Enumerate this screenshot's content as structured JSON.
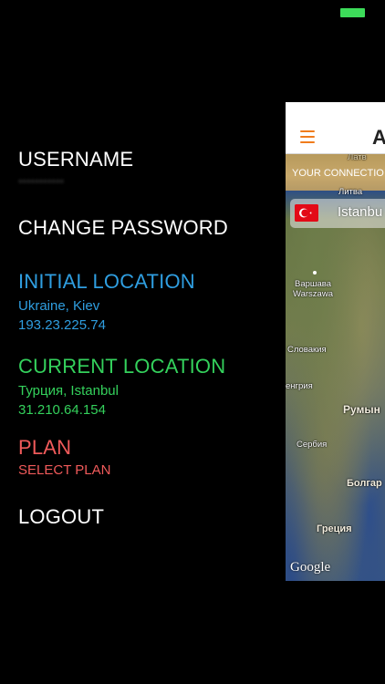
{
  "status_bar": {
    "battery_color": "#3ddc5a"
  },
  "menu": {
    "username_label": "USERNAME",
    "change_password_label": "CHANGE PASSWORD",
    "initial_location": {
      "title": "INITIAL LOCATION",
      "place": "Ukraine, Kiev",
      "ip": "193.23.225.74",
      "color": "#2f9ee0"
    },
    "current_location": {
      "title": "CURRENT LOCATION",
      "place": "Турция, Istanbul",
      "ip": "31.210.64.154",
      "color": "#34d15c"
    },
    "plan": {
      "title": "PLAN",
      "action": "SELECT PLAN",
      "color": "#f05a5a"
    },
    "logout_label": "LOGOUT"
  },
  "app_panel": {
    "menu_icon": "hamburger-icon",
    "title_fragment": "A",
    "banner_text": "YOUR CONNECTIO",
    "location_chip": {
      "flag_icon": "turkey-flag-icon",
      "city": "Istanbu"
    },
    "map_labels": {
      "latvia": "Латв",
      "lithuania": "Литва",
      "warsaw_ru": "Варшава",
      "warsaw": "Warszawa",
      "slovakia": "Словакия",
      "hungary": "енгрия",
      "romania": "Румын",
      "serbia": "Сербия",
      "bulgaria": "Болгар",
      "greece": "Греция"
    },
    "map_attribution": "Google",
    "accent_color": "#f07c1c"
  }
}
